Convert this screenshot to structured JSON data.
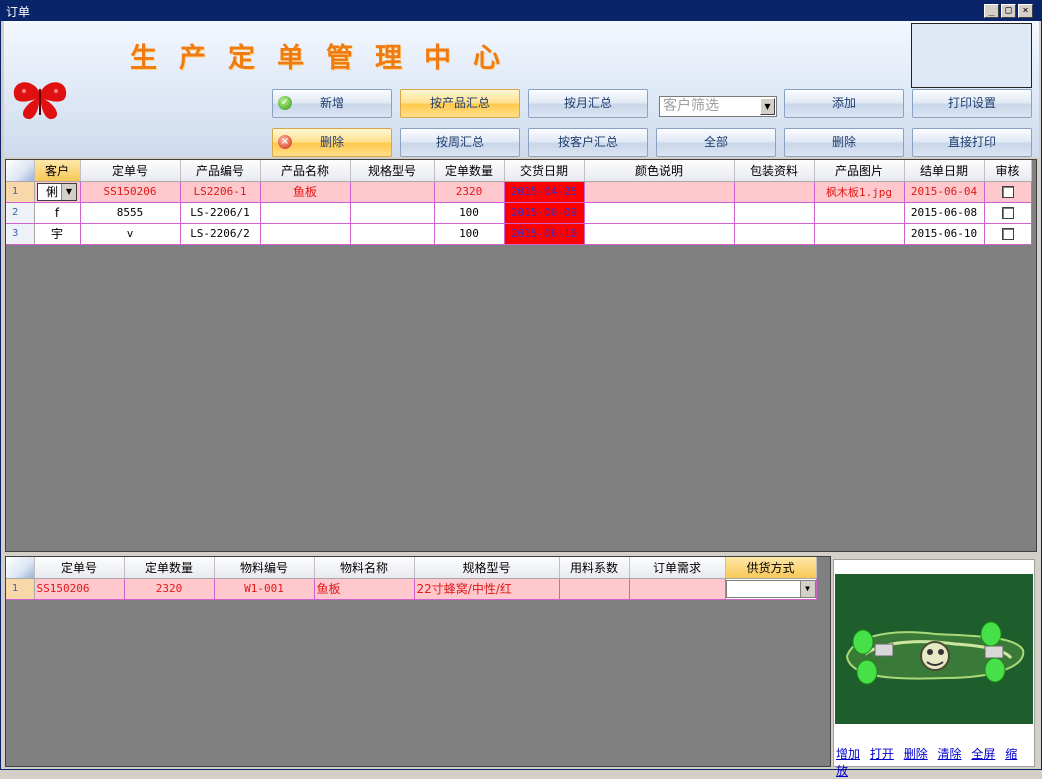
{
  "window": {
    "title": "订单",
    "min": "_",
    "max": "□",
    "close": "×"
  },
  "header": {
    "app_title": "生产定单管理中心"
  },
  "toolbar": {
    "row1": [
      "新增",
      "按产品汇总",
      "按月汇总",
      "添加",
      "打印设置"
    ],
    "row2": [
      "删除",
      "按周汇总",
      "按客户汇总",
      "全部",
      "删除",
      "直接打印"
    ],
    "customer_filter_placeholder": "客户筛选"
  },
  "orders": {
    "columns": [
      "客户",
      "定单号",
      "产品编号",
      "产品名称",
      "规格型号",
      "定单数量",
      "交货日期",
      "颜色说明",
      "包装资料",
      "产品图片",
      "结单日期",
      "审核"
    ],
    "rows": [
      {
        "num": "1",
        "customer": "俐",
        "order_no": "SS150206",
        "product_code": "LS2206-1",
        "product_name": "鱼板",
        "spec": "",
        "qty": "2320",
        "delivery": "2015-04-25",
        "color": "",
        "packing": "",
        "image": "枫木板1.jpg",
        "close_date": "2015-06-04",
        "approved": false
      },
      {
        "num": "2",
        "customer": "f",
        "order_no": "8555",
        "product_code": "LS-2206/1",
        "product_name": "",
        "spec": "",
        "qty": "100",
        "delivery": "2015-06-09",
        "color": "",
        "packing": "",
        "image": "",
        "close_date": "2015-06-08",
        "approved": false
      },
      {
        "num": "3",
        "customer": "宇",
        "order_no": "v",
        "product_code": "LS-2206/2",
        "product_name": "",
        "spec": "",
        "qty": "100",
        "delivery": "2015-06-10",
        "color": "",
        "packing": "",
        "image": "",
        "close_date": "2015-06-10",
        "approved": false
      }
    ]
  },
  "materials": {
    "columns": [
      "定单号",
      "定单数量",
      "物料编号",
      "物料名称",
      "规格型号",
      "用料系数",
      "订单需求",
      "供货方式"
    ],
    "rows": [
      {
        "num": "1",
        "order_no": "SS150206",
        "qty": "2320",
        "mat_code": "W1-001",
        "mat_name": "鱼板",
        "spec": "22寸蜂窝/中性/红",
        "ratio": "",
        "demand": "",
        "supply": ""
      }
    ]
  },
  "photo_links": [
    "增加",
    "打开",
    "删除",
    "清除",
    "全屏",
    "缩放"
  ],
  "colors": {
    "accent_orange": "#f07b10",
    "title_bar": "#0a246a",
    "row_highlight": "#ffc8cc",
    "date_overdue": "#ff0000"
  }
}
